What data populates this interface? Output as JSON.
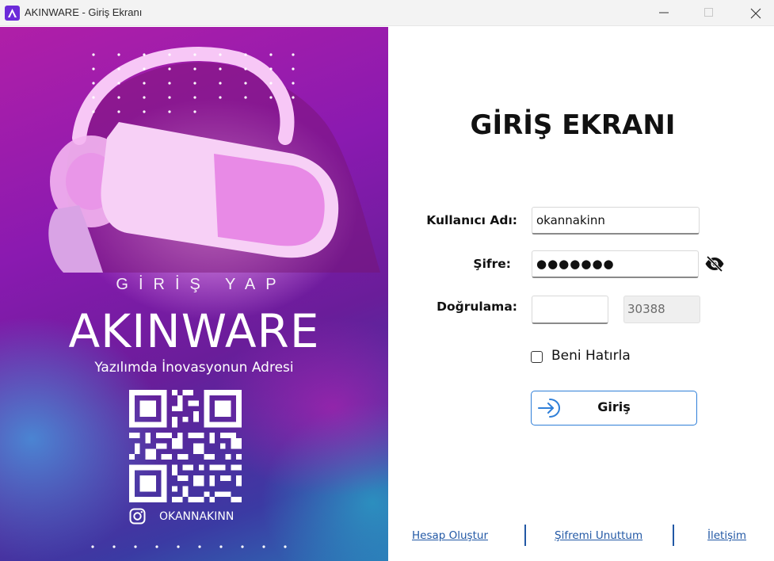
{
  "window": {
    "title": "AKINWARE - Giriş Ekranı",
    "logo_letter": "A",
    "controls": [
      "minimize-icon",
      "maximize-icon",
      "close-icon"
    ]
  },
  "banner": {
    "subtitle": "GİRİŞ YAP",
    "brand": "AKINWARE",
    "slogan": "Yazılımda İnovasyonun Adresi",
    "instagram_handle": "OKANNAKINN",
    "colors": {
      "magenta": "#b01fa8",
      "purple": "#6a1d9a",
      "blue": "#2d6fb4"
    }
  },
  "form": {
    "title": "GİRİŞ EKRANI",
    "username_label": "Kullanıcı Adı:",
    "username_value": "okannakinn",
    "password_label": "Şifre:",
    "password_masked": "●●●●●●●",
    "verify_label": "Doğrulama:",
    "verify_value": "",
    "captcha_code": "30388",
    "remember_label": "Beni Hatırla",
    "remember_checked": false,
    "login_label": "Giriş",
    "accent_color": "#2f7fd8"
  },
  "footer": {
    "create_account": "Hesap Oluştur",
    "forgot_password": "Şifremi Unuttum",
    "contact": "İletişim",
    "link_color": "#2258a5"
  }
}
